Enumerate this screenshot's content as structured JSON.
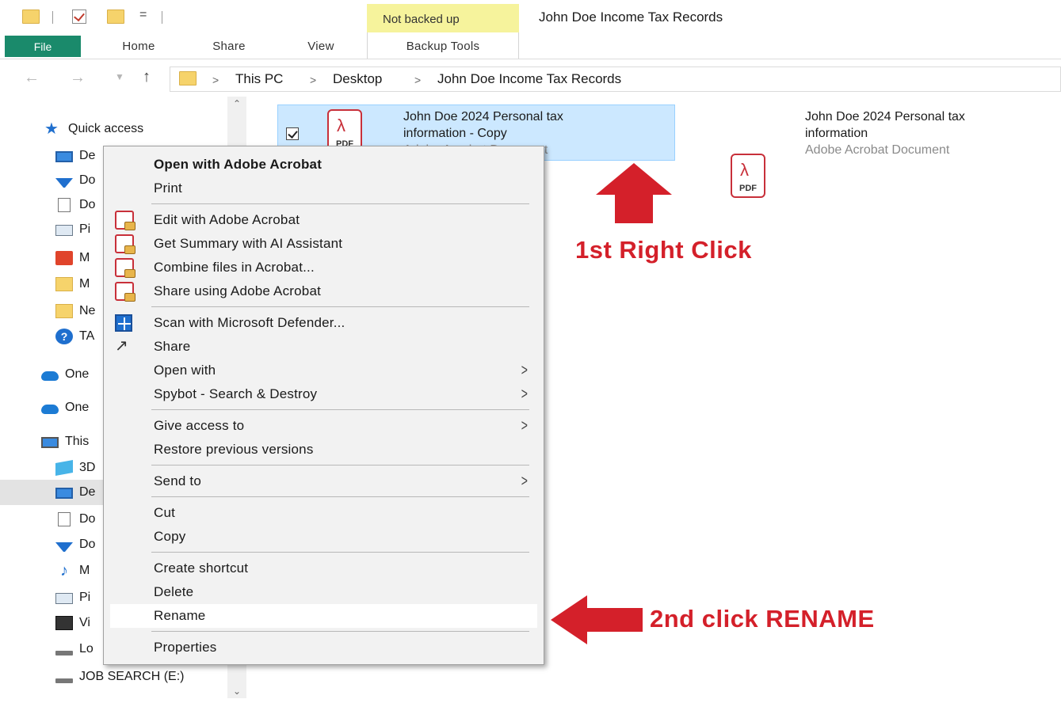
{
  "window": {
    "title": "John Doe Income Tax Records",
    "contextual_tab_group": "Not backed up",
    "qa_dropdown": "="
  },
  "ribbon": {
    "tabs": [
      "File",
      "Home",
      "Share",
      "View",
      "Backup Tools"
    ]
  },
  "address_bar": {
    "crumbs": [
      "This PC",
      "Desktop",
      "John Doe Income Tax Records"
    ],
    "separator": ">"
  },
  "nav_pane": {
    "items": [
      {
        "label": "Quick access",
        "icon": "star-icon"
      },
      {
        "label": "De",
        "icon": "desktop-icon"
      },
      {
        "label": "Do",
        "icon": "downloads-icon"
      },
      {
        "label": "Do",
        "icon": "documents-icon"
      },
      {
        "label": "Pi",
        "icon": "pictures-icon"
      },
      {
        "label": "M",
        "icon": "office-icon"
      },
      {
        "label": "M",
        "icon": "folder-icon"
      },
      {
        "label": "Ne",
        "icon": "folder-icon"
      },
      {
        "label": "TA",
        "icon": "help-icon"
      },
      {
        "label": "One",
        "icon": "onedrive-icon"
      },
      {
        "label": "One",
        "icon": "onedrive-icon"
      },
      {
        "label": "This",
        "icon": "this-pc-icon"
      },
      {
        "label": "3D",
        "icon": "3d-objects-icon"
      },
      {
        "label": "De",
        "icon": "desktop-icon"
      },
      {
        "label": "Do",
        "icon": "documents-icon"
      },
      {
        "label": "Do",
        "icon": "downloads-icon"
      },
      {
        "label": "M",
        "icon": "music-icon"
      },
      {
        "label": "Pi",
        "icon": "pictures-icon"
      },
      {
        "label": "Vi",
        "icon": "videos-icon"
      },
      {
        "label": "Lo",
        "icon": "local-disk-icon"
      },
      {
        "label": "JOB SEARCH (E:)",
        "icon": "drive-icon"
      }
    ]
  },
  "files": [
    {
      "name_line1": "John Doe 2024 Personal tax",
      "name_line2": "information - Copy",
      "type": "Adobe Acrobat Document",
      "icon_label": "PDF",
      "selected": true
    },
    {
      "name_line1": "John Doe 2024 Personal tax",
      "name_line2": "information",
      "type": "Adobe Acrobat Document",
      "icon_label": "PDF",
      "selected": false
    }
  ],
  "context_menu": {
    "items": [
      {
        "label": "Open with Adobe Acrobat",
        "bold": true
      },
      {
        "label": "Print"
      },
      {
        "label": "Edit with Adobe Acrobat",
        "icon": "acrobat-edit-icon"
      },
      {
        "label": "Get Summary with AI Assistant",
        "icon": "acrobat-ai-icon"
      },
      {
        "label": "Combine files in Acrobat...",
        "icon": "acrobat-combine-icon"
      },
      {
        "label": "Share using Adobe Acrobat",
        "icon": "acrobat-share-icon"
      },
      {
        "label": "Scan with Microsoft Defender...",
        "icon": "defender-icon"
      },
      {
        "label": "Share",
        "icon": "share-icon"
      },
      {
        "label": "Open with",
        "submenu": true
      },
      {
        "label": "Spybot - Search & Destroy",
        "submenu": true
      },
      {
        "label": "Give access to",
        "submenu": true
      },
      {
        "label": "Restore previous versions"
      },
      {
        "label": "Send to",
        "submenu": true
      },
      {
        "label": "Cut"
      },
      {
        "label": "Copy"
      },
      {
        "label": "Create shortcut"
      },
      {
        "label": "Delete"
      },
      {
        "label": "Rename",
        "highlighted": true
      },
      {
        "label": "Properties"
      }
    ],
    "submenu_glyph": ">"
  },
  "annotations": {
    "first": "1st Right Click",
    "second": "2nd click RENAME",
    "color": "#d4202a"
  },
  "colors": {
    "file_tab": "#1a8a6b",
    "contextual_band": "#f6f39c",
    "selection": "#cce8ff",
    "pdf_red": "#c8303a"
  }
}
